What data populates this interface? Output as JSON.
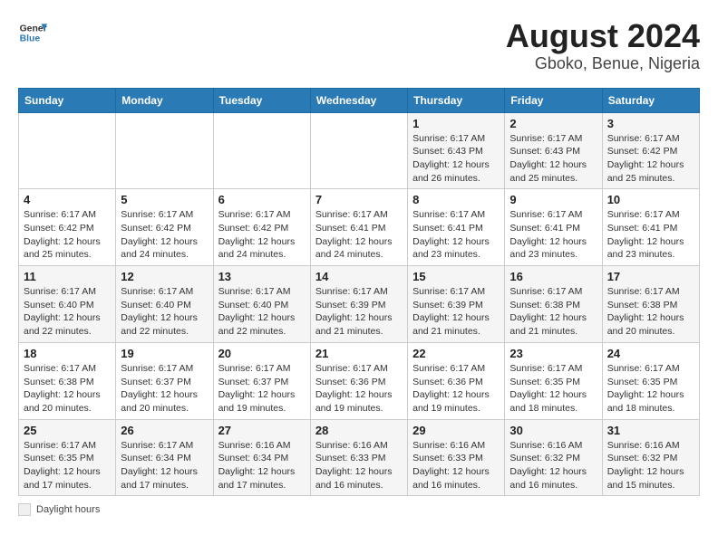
{
  "header": {
    "logo_line1": "General",
    "logo_line2": "Blue",
    "title": "August 2024",
    "subtitle": "Gboko, Benue, Nigeria"
  },
  "days_of_week": [
    "Sunday",
    "Monday",
    "Tuesday",
    "Wednesday",
    "Thursday",
    "Friday",
    "Saturday"
  ],
  "footnote": "Daylight hours",
  "weeks": [
    [
      {
        "day": "",
        "info": ""
      },
      {
        "day": "",
        "info": ""
      },
      {
        "day": "",
        "info": ""
      },
      {
        "day": "",
        "info": ""
      },
      {
        "day": "1",
        "info": "Sunrise: 6:17 AM\nSunset: 6:43 PM\nDaylight: 12 hours\nand 26 minutes."
      },
      {
        "day": "2",
        "info": "Sunrise: 6:17 AM\nSunset: 6:43 PM\nDaylight: 12 hours\nand 25 minutes."
      },
      {
        "day": "3",
        "info": "Sunrise: 6:17 AM\nSunset: 6:42 PM\nDaylight: 12 hours\nand 25 minutes."
      }
    ],
    [
      {
        "day": "4",
        "info": "Sunrise: 6:17 AM\nSunset: 6:42 PM\nDaylight: 12 hours\nand 25 minutes."
      },
      {
        "day": "5",
        "info": "Sunrise: 6:17 AM\nSunset: 6:42 PM\nDaylight: 12 hours\nand 24 minutes."
      },
      {
        "day": "6",
        "info": "Sunrise: 6:17 AM\nSunset: 6:42 PM\nDaylight: 12 hours\nand 24 minutes."
      },
      {
        "day": "7",
        "info": "Sunrise: 6:17 AM\nSunset: 6:41 PM\nDaylight: 12 hours\nand 24 minutes."
      },
      {
        "day": "8",
        "info": "Sunrise: 6:17 AM\nSunset: 6:41 PM\nDaylight: 12 hours\nand 23 minutes."
      },
      {
        "day": "9",
        "info": "Sunrise: 6:17 AM\nSunset: 6:41 PM\nDaylight: 12 hours\nand 23 minutes."
      },
      {
        "day": "10",
        "info": "Sunrise: 6:17 AM\nSunset: 6:41 PM\nDaylight: 12 hours\nand 23 minutes."
      }
    ],
    [
      {
        "day": "11",
        "info": "Sunrise: 6:17 AM\nSunset: 6:40 PM\nDaylight: 12 hours\nand 22 minutes."
      },
      {
        "day": "12",
        "info": "Sunrise: 6:17 AM\nSunset: 6:40 PM\nDaylight: 12 hours\nand 22 minutes."
      },
      {
        "day": "13",
        "info": "Sunrise: 6:17 AM\nSunset: 6:40 PM\nDaylight: 12 hours\nand 22 minutes."
      },
      {
        "day": "14",
        "info": "Sunrise: 6:17 AM\nSunset: 6:39 PM\nDaylight: 12 hours\nand 21 minutes."
      },
      {
        "day": "15",
        "info": "Sunrise: 6:17 AM\nSunset: 6:39 PM\nDaylight: 12 hours\nand 21 minutes."
      },
      {
        "day": "16",
        "info": "Sunrise: 6:17 AM\nSunset: 6:38 PM\nDaylight: 12 hours\nand 21 minutes."
      },
      {
        "day": "17",
        "info": "Sunrise: 6:17 AM\nSunset: 6:38 PM\nDaylight: 12 hours\nand 20 minutes."
      }
    ],
    [
      {
        "day": "18",
        "info": "Sunrise: 6:17 AM\nSunset: 6:38 PM\nDaylight: 12 hours\nand 20 minutes."
      },
      {
        "day": "19",
        "info": "Sunrise: 6:17 AM\nSunset: 6:37 PM\nDaylight: 12 hours\nand 20 minutes."
      },
      {
        "day": "20",
        "info": "Sunrise: 6:17 AM\nSunset: 6:37 PM\nDaylight: 12 hours\nand 19 minutes."
      },
      {
        "day": "21",
        "info": "Sunrise: 6:17 AM\nSunset: 6:36 PM\nDaylight: 12 hours\nand 19 minutes."
      },
      {
        "day": "22",
        "info": "Sunrise: 6:17 AM\nSunset: 6:36 PM\nDaylight: 12 hours\nand 19 minutes."
      },
      {
        "day": "23",
        "info": "Sunrise: 6:17 AM\nSunset: 6:35 PM\nDaylight: 12 hours\nand 18 minutes."
      },
      {
        "day": "24",
        "info": "Sunrise: 6:17 AM\nSunset: 6:35 PM\nDaylight: 12 hours\nand 18 minutes."
      }
    ],
    [
      {
        "day": "25",
        "info": "Sunrise: 6:17 AM\nSunset: 6:35 PM\nDaylight: 12 hours\nand 17 minutes."
      },
      {
        "day": "26",
        "info": "Sunrise: 6:17 AM\nSunset: 6:34 PM\nDaylight: 12 hours\nand 17 minutes."
      },
      {
        "day": "27",
        "info": "Sunrise: 6:16 AM\nSunset: 6:34 PM\nDaylight: 12 hours\nand 17 minutes."
      },
      {
        "day": "28",
        "info": "Sunrise: 6:16 AM\nSunset: 6:33 PM\nDaylight: 12 hours\nand 16 minutes."
      },
      {
        "day": "29",
        "info": "Sunrise: 6:16 AM\nSunset: 6:33 PM\nDaylight: 12 hours\nand 16 minutes."
      },
      {
        "day": "30",
        "info": "Sunrise: 6:16 AM\nSunset: 6:32 PM\nDaylight: 12 hours\nand 16 minutes."
      },
      {
        "day": "31",
        "info": "Sunrise: 6:16 AM\nSunset: 6:32 PM\nDaylight: 12 hours\nand 15 minutes."
      }
    ]
  ]
}
